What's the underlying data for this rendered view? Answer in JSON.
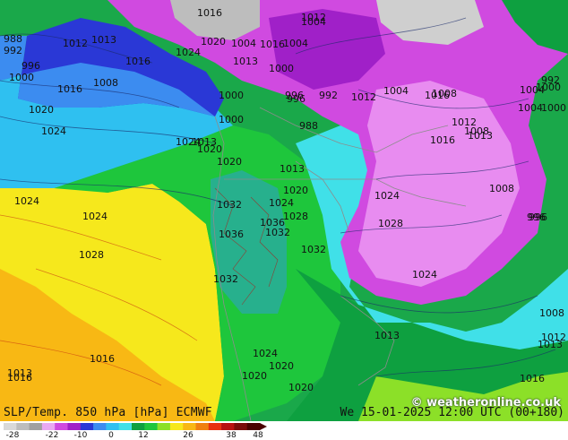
{
  "title_left": "SLP/Temp. 850 hPa [hPa] ECMWF",
  "title_right": "We 15-01-2025 12:00 UTC (00+180)",
  "credit": "© weatheronline.co.uk",
  "legend": {
    "ticks": [
      "-28",
      "-22",
      "-10",
      "0",
      "12",
      "26",
      "38",
      "48"
    ],
    "colors": [
      "#d9d9d9",
      "#bdbdbd",
      "#a0a0a0",
      "#e9a9f2",
      "#d04ae0",
      "#a020c8",
      "#2a38d6",
      "#3c8cf0",
      "#2fc0f0",
      "#40e0e8",
      "#0ea040",
      "#1ec63c",
      "#8ce028",
      "#f6e81c",
      "#f8b814",
      "#f08010",
      "#e83010",
      "#b81010",
      "#7a0a0a",
      "#4a0000"
    ]
  },
  "isobars": [
    {
      "t": "988",
      "c": "dark"
    },
    {
      "t": "992",
      "c": "dark"
    },
    {
      "t": "996",
      "c": "dark"
    },
    {
      "t": "1000",
      "c": "dark"
    },
    {
      "t": "1012",
      "c": "dark"
    },
    {
      "t": "1013",
      "c": "dark"
    },
    {
      "t": "1016",
      "c": "dark"
    },
    {
      "t": "1008",
      "c": "dark"
    },
    {
      "t": "1020",
      "c": "dark"
    },
    {
      "t": "1024",
      "c": "dark"
    },
    {
      "t": "1016",
      "c": "dark"
    },
    {
      "t": "1004",
      "c": "dark"
    },
    {
      "t": "1020",
      "c": "dark"
    },
    {
      "t": "1024",
      "c": "dark"
    },
    {
      "t": "1013",
      "c": "dark"
    },
    {
      "t": "1016",
      "c": "dark"
    },
    {
      "t": "1004",
      "c": "dark"
    },
    {
      "t": "1000",
      "c": "dark"
    },
    {
      "t": "1000",
      "c": "dark"
    },
    {
      "t": "996",
      "c": "dark"
    },
    {
      "t": "988",
      "c": "dark"
    },
    {
      "t": "1024",
      "c": "dark"
    },
    {
      "t": "1013",
      "c": "dark"
    },
    {
      "t": "1020",
      "c": "dark"
    },
    {
      "t": "1024",
      "c": "dark"
    },
    {
      "t": "1028",
      "c": "dark"
    },
    {
      "t": "1032",
      "c": "dark"
    },
    {
      "t": "1036",
      "c": "dark"
    },
    {
      "t": "1032",
      "c": "dark"
    },
    {
      "t": "1028",
      "c": "dark"
    },
    {
      "t": "1032",
      "c": "dark"
    },
    {
      "t": "1036",
      "c": "dark"
    },
    {
      "t": "1032",
      "c": "dark"
    },
    {
      "t": "1024",
      "c": "dark"
    },
    {
      "t": "1020",
      "c": "dark"
    },
    {
      "t": "1016",
      "c": "dark"
    },
    {
      "t": "1016",
      "c": "dark"
    },
    {
      "t": "1013",
      "c": "dark"
    },
    {
      "t": "1020",
      "c": "dark"
    },
    {
      "t": "1024",
      "c": "dark"
    },
    {
      "t": "1020",
      "c": "dark"
    },
    {
      "t": "1020",
      "c": "dark"
    },
    {
      "t": "1024",
      "c": "dark"
    },
    {
      "t": "1028",
      "c": "dark"
    },
    {
      "t": "1024",
      "c": "dark"
    },
    {
      "t": "1013",
      "c": "dark"
    },
    {
      "t": "1016",
      "c": "dark"
    },
    {
      "t": "1008",
      "c": "dark"
    },
    {
      "t": "1012",
      "c": "dark"
    },
    {
      "t": "1013",
      "c": "dark"
    },
    {
      "t": "1016",
      "c": "dark"
    },
    {
      "t": "1008",
      "c": "dark"
    },
    {
      "t": "1004",
      "c": "dark"
    },
    {
      "t": "1000",
      "c": "dark"
    },
    {
      "t": "992",
      "c": "dark"
    },
    {
      "t": "996",
      "c": "dark"
    },
    {
      "t": "1008",
      "c": "dark"
    },
    {
      "t": "1013",
      "c": "dark"
    },
    {
      "t": "1012",
      "c": "dark"
    },
    {
      "t": "1016",
      "c": "dark"
    },
    {
      "t": "1004",
      "c": "dark"
    },
    {
      "t": "1008",
      "c": "dark"
    },
    {
      "t": "1012",
      "c": "dark"
    },
    {
      "t": "1016",
      "c": "dark"
    },
    {
      "t": "1004",
      "c": "dark"
    },
    {
      "t": "1000",
      "c": "dark"
    },
    {
      "t": "996",
      "c": "dark"
    },
    {
      "t": "992",
      "c": "dark"
    },
    {
      "t": "1024",
      "c": "dark"
    },
    {
      "t": "1020",
      "c": "dark"
    },
    {
      "t": "1013",
      "c": "dark"
    },
    {
      "t": "1012",
      "c": "dark"
    },
    {
      "t": "1004",
      "c": "dark"
    },
    {
      "t": "1000",
      "c": "dark"
    },
    {
      "t": "996",
      "c": "dark"
    }
  ]
}
